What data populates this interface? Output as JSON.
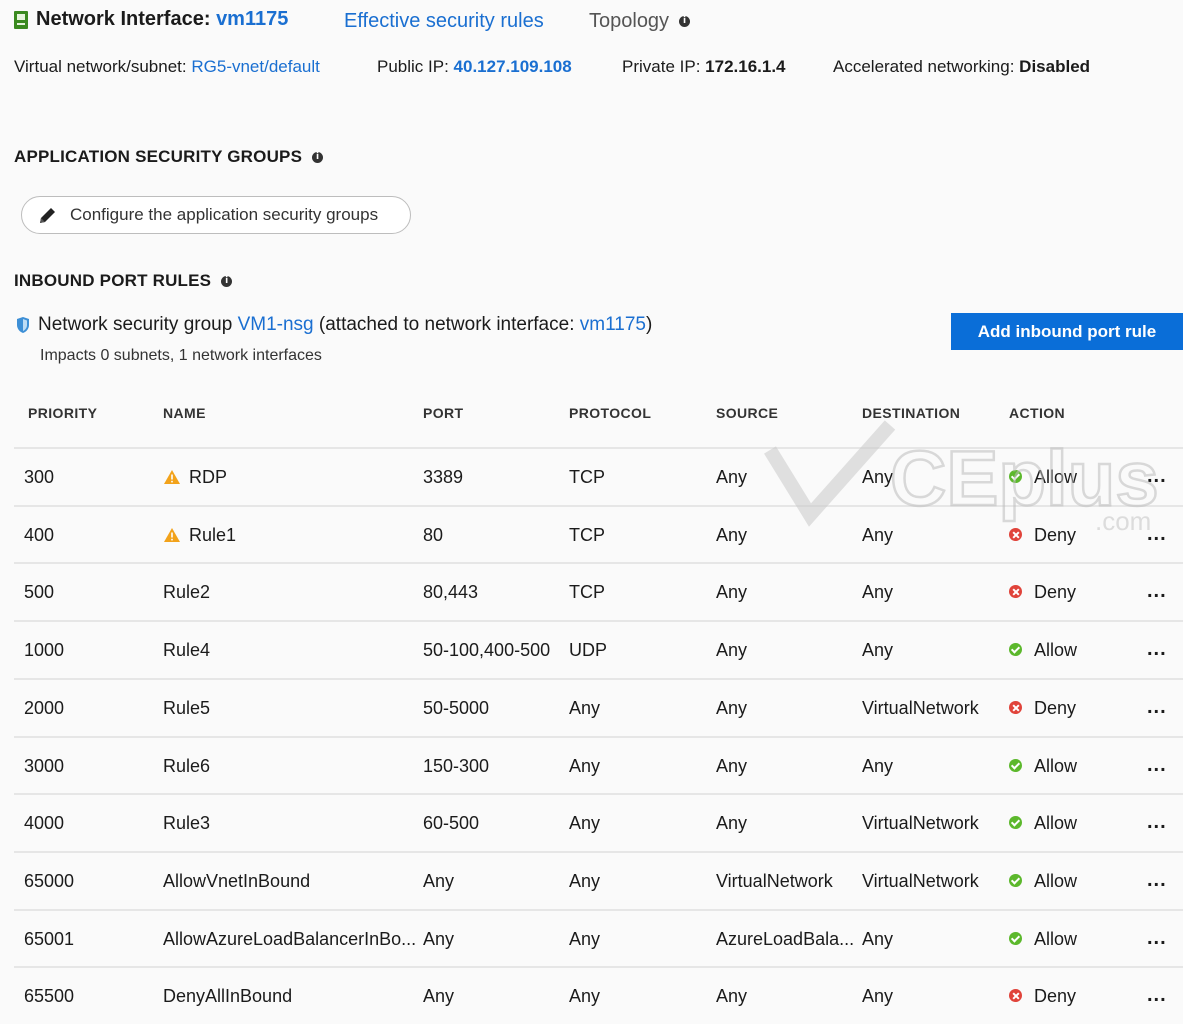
{
  "header": {
    "title_prefix": "Network Interface:",
    "title_name": "vm1175",
    "tab_effective": "Effective security rules",
    "tab_topology": "Topology",
    "vnet_label": "Virtual network/subnet:",
    "vnet_value": "RG5-vnet/default",
    "public_ip_label": "Public IP:",
    "public_ip_value": "40.127.109.108",
    "private_ip_label": "Private IP:",
    "private_ip_value": "172.16.1.4",
    "accel_label": "Accelerated networking:",
    "accel_value": "Disabled"
  },
  "asg": {
    "heading": "APPLICATION SECURITY GROUPS",
    "configure_label": "Configure the application security groups"
  },
  "inbound": {
    "heading": "INBOUND PORT RULES",
    "nsg_prefix": "Network security group",
    "nsg_name": "VM1-nsg",
    "nsg_attached_prefix": "(attached to network interface:",
    "nsg_attached_nic": "vm1175",
    "nsg_attached_suffix": ")",
    "impacts": "Impacts 0 subnets, 1 network interfaces",
    "add_button": "Add inbound port rule"
  },
  "table": {
    "columns": [
      "PRIORITY",
      "NAME",
      "PORT",
      "PROTOCOL",
      "SOURCE",
      "DESTINATION",
      "ACTION"
    ],
    "rows": [
      {
        "priority": "300",
        "name": "RDP",
        "warning": true,
        "port": "3389",
        "protocol": "TCP",
        "source": "Any",
        "destination": "Any",
        "action": "Allow"
      },
      {
        "priority": "400",
        "name": "Rule1",
        "warning": true,
        "port": "80",
        "protocol": "TCP",
        "source": "Any",
        "destination": "Any",
        "action": "Deny"
      },
      {
        "priority": "500",
        "name": "Rule2",
        "warning": false,
        "port": "80,443",
        "protocol": "TCP",
        "source": "Any",
        "destination": "Any",
        "action": "Deny"
      },
      {
        "priority": "1000",
        "name": "Rule4",
        "warning": false,
        "port": "50-100,400-500",
        "protocol": "UDP",
        "source": "Any",
        "destination": "Any",
        "action": "Allow"
      },
      {
        "priority": "2000",
        "name": "Rule5",
        "warning": false,
        "port": "50-5000",
        "protocol": "Any",
        "source": "Any",
        "destination": "VirtualNetwork",
        "action": "Deny"
      },
      {
        "priority": "3000",
        "name": "Rule6",
        "warning": false,
        "port": "150-300",
        "protocol": "Any",
        "source": "Any",
        "destination": "Any",
        "action": "Allow"
      },
      {
        "priority": "4000",
        "name": "Rule3",
        "warning": false,
        "port": "60-500",
        "protocol": "Any",
        "source": "Any",
        "destination": "VirtualNetwork",
        "action": "Allow"
      },
      {
        "priority": "65000",
        "name": "AllowVnetInBound",
        "warning": false,
        "port": "Any",
        "protocol": "Any",
        "source": "VirtualNetwork",
        "destination": "VirtualNetwork",
        "action": "Allow"
      },
      {
        "priority": "65001",
        "name": "AllowAzureLoadBalancerInBo...",
        "warning": false,
        "port": "Any",
        "protocol": "Any",
        "source": "AzureLoadBala...",
        "destination": "Any",
        "action": "Allow"
      },
      {
        "priority": "65500",
        "name": "DenyAllInBound",
        "warning": false,
        "port": "Any",
        "protocol": "Any",
        "source": "Any",
        "destination": "Any",
        "action": "Deny"
      }
    ],
    "more_glyph": "..."
  },
  "watermark": {
    "brand": "CEplus",
    "domain": ".com"
  },
  "icons": {
    "title": "network-interface-icon",
    "info": "info-icon",
    "configure": "pencil-icon",
    "nsg": "shield-icon",
    "warning": "warning-icon",
    "allow": "check-circle-icon",
    "deny": "x-circle-icon"
  },
  "colors": {
    "link": "#1a6fd1",
    "primary_button": "#0a6ed8",
    "allow": "#5cb82c",
    "deny": "#e0433a",
    "warning": "#f2a21a"
  }
}
